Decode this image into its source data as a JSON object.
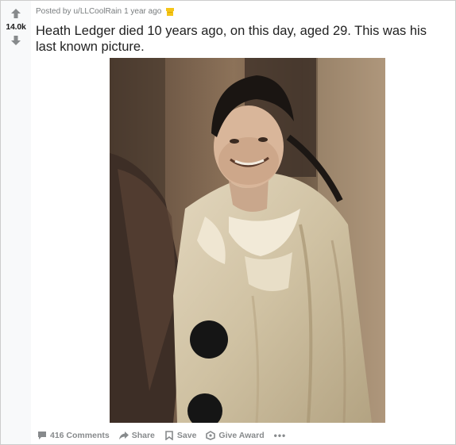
{
  "vote": {
    "score": "14.0k",
    "upvote_icon": "arrow-up-icon",
    "downvote_icon": "arrow-down-icon"
  },
  "meta": {
    "posted_by": "Posted by",
    "author": "u/LLCoolRain",
    "time": "1 year ago",
    "award_icon": "award-badge-icon",
    "award_color": "#f5c518"
  },
  "title": "Heath Ledger died 10 years ago, on this day, aged 29. This was his last known picture.",
  "footer": {
    "comments": "416 Comments",
    "share": "Share",
    "save": "Save",
    "give_award": "Give Award",
    "more": "•••"
  },
  "colors": {
    "rail_bg": "#f8f9fa",
    "meta_text": "#787c7e",
    "action_text": "#878a8c"
  }
}
